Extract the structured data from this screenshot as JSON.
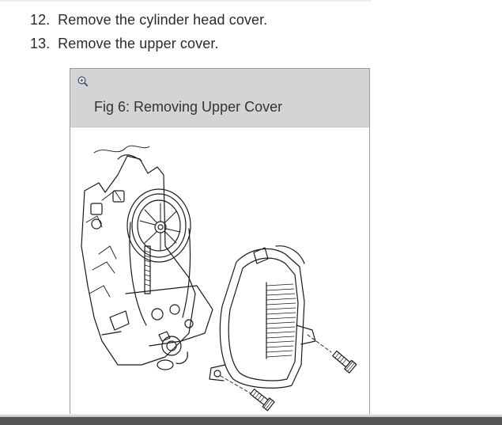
{
  "steps": [
    {
      "number": "12.",
      "text": "Remove the cylinder head cover."
    },
    {
      "number": "13.",
      "text": "Remove the upper cover."
    }
  ],
  "figure": {
    "title": "Fig 6: Removing Upper Cover",
    "zoom_icon": "zoom-in-icon"
  },
  "colors": {
    "caption_bg": "#d4d4d4",
    "border": "#9a9a9a",
    "footer": "#555555"
  }
}
